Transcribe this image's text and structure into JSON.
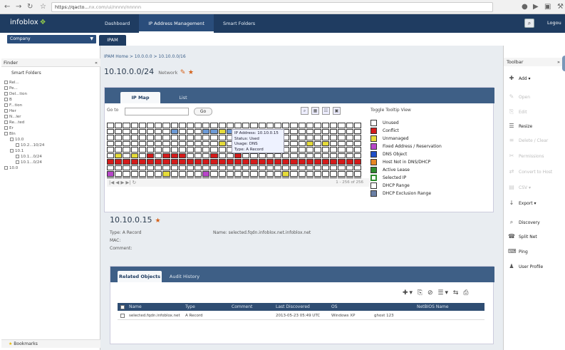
{
  "browser": {
    "url_host": "https://qacto...",
    "url_rest": "nx.com/ui/nnnn/nnnnn"
  },
  "app": {
    "logo": "infoblox",
    "logo_mark": "❖",
    "nav": [
      "Dashboard",
      "IP Address Management",
      "Smart Folders"
    ],
    "logout": "Logou"
  },
  "subbar": {
    "combo": "Company",
    "tab": "IPAM"
  },
  "finder": {
    "title": "Finder",
    "smart_folder": "Smart Folders",
    "tree": [
      "Rel...",
      "Pe...",
      "Del...tion",
      "B",
      "F...tion",
      "Her",
      "N...ler",
      "Re...ted",
      "Er",
      "Bln",
      "10.0",
      "10.2...10/24",
      "10.1",
      "10.1...0/24",
      "10.1...0/24",
      "10.0"
    ],
    "bookmarks": "Bookmarks"
  },
  "breadcrumb": "IPAM Home > 10.0.0.0 > 10.10.0.0/16",
  "title": {
    "network": "10.10.0.0/24",
    "sub": "Network"
  },
  "ipmap": {
    "tabs": [
      "IP Map",
      "List"
    ],
    "goto_label": "Go to",
    "go_button": "Go",
    "legend_header": "Toggle Tooltip View",
    "legend": [
      {
        "label": "Unused",
        "color": "#ffffff"
      },
      {
        "label": "Conflict",
        "color": "#d41b1b"
      },
      {
        "label": "Unmanaged",
        "color": "#e6dc3a"
      },
      {
        "label": "Fixed Address / Reservation",
        "color": "#b846c9"
      },
      {
        "label": "DNS Object",
        "color": "#1f4ec8"
      },
      {
        "label": "Host Not in DNS/DHCP",
        "color": "#e68623"
      },
      {
        "label": "Active Lease",
        "color": "#2e8b2e"
      },
      {
        "label": "Selected IP",
        "color": "#ffffff"
      },
      {
        "label": "DHCP Range",
        "color": "#ffffff"
      },
      {
        "label": "DHCP Exclusion Range",
        "color": "#6a7fa5"
      }
    ],
    "tooltip": [
      "IP Address: 10.10.0.15",
      "Status: Used",
      "Usage: DNS",
      "Type: A Record"
    ],
    "pager_range": "1 - 256 of 256",
    "pager_icons": "|◀ ◀ ▶ ▶| ↻",
    "grid": [
      "WWWWWWWWWWWWWWWWWWWWWWWWWWWWWWWW",
      "WWWWWWWWUWWWUUYUGWWWUWWWWWWWWWWW",
      "WWWWWWWWWWWWWWWWWWWWWWWWWWWWWWWW",
      "WWWWWWWWWWWWWWYWWWWWWWWWWYWYWWWW",
      "WWWWWWWWWWWWWWWWWWWWWWWWWWWWWWWW",
      "WYWYWRWRRRWWWRWWRWWWWWWWWWWWWWWW",
      "RRRRRRRRRRRRRRRRRRRRRRRRRRRRRRRR",
      "WWWWWWWWWWWWWWWWWWWWWWWWWWWWWWWW",
      "PWWWWWWYWWWWPWWWWWWWWWYWWWWWWWWW",
      "WWWWWWWWWWWWWWWWWWWWWWWWWWWWWWWW"
    ]
  },
  "selected_ip": {
    "address": "10.10.0.15",
    "type_label": "Type: A Record",
    "mac_label": "MAC:",
    "comment_label": "Comment:",
    "name_label": "Name: selected.fqdn.infoblox.net.infoblox.net"
  },
  "related": {
    "tabs": [
      "Related Objects",
      "Audit History"
    ],
    "toolbar": "✚▾ ⎘ ⊘ ☰▾ ⇆ ⎙",
    "headers": [
      "Name",
      "Type",
      "Comment",
      "Last Discovered",
      "OS",
      "NetBIOS Name"
    ],
    "row": [
      "selected.fqdn.infoblox.net",
      "A Record",
      "",
      "2013-05-23 05:49 UTC",
      "Windows XP",
      "ghost 123"
    ]
  },
  "toolbar": {
    "title": "Toolbar",
    "items": [
      {
        "icon": "✚",
        "label": "Add ▾",
        "enabled": true
      },
      {
        "icon": "✎",
        "label": "Open",
        "enabled": false
      },
      {
        "icon": "⎘",
        "label": "Edit",
        "enabled": false
      },
      {
        "icon": "☰",
        "label": "Resize",
        "enabled": true
      },
      {
        "icon": "≡",
        "label": "Delete / Clear",
        "enabled": false
      },
      {
        "icon": "✂",
        "label": "Permissions",
        "enabled": false
      },
      {
        "icon": "⇄",
        "label": "Convert to Host",
        "enabled": false
      },
      {
        "icon": "▤",
        "label": "CSV ▾",
        "enabled": false
      },
      {
        "icon": "↓",
        "label": "Export ▾",
        "enabled": true
      },
      {
        "icon": "⌕",
        "label": "Discovery",
        "enabled": true
      },
      {
        "icon": "☎",
        "label": "Split Net",
        "enabled": true
      },
      {
        "icon": "⌨",
        "label": "Ping",
        "enabled": true
      },
      {
        "icon": "♟",
        "label": "User Profile",
        "enabled": true
      }
    ]
  },
  "colors": {
    "W": "#ffffff",
    "R": "#d41b1b",
    "Y": "#e6dc3a",
    "U": "#6d9bd8",
    "G": "#3aa83a",
    "P": "#b846c9"
  }
}
